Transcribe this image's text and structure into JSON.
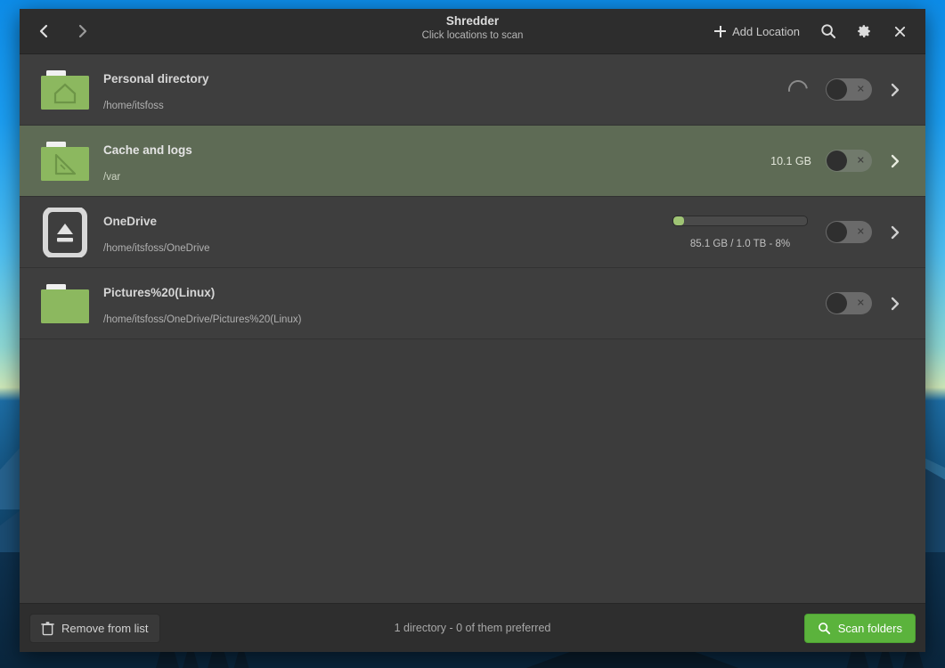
{
  "window": {
    "title": "Shredder",
    "subtitle": "Click locations to scan"
  },
  "header": {
    "back_icon": "chevron-left-icon",
    "forward_icon": "chevron-right-icon",
    "add_location_label": "Add Location",
    "add_location_icon": "plus-icon",
    "search_icon": "search-icon",
    "settings_icon": "gear-icon",
    "close_icon": "close-icon"
  },
  "locations": [
    {
      "title": "Personal directory",
      "path": "/home/itsfoss",
      "icon": "home-folder-icon",
      "selected": false,
      "size": "",
      "spinner": true,
      "toggle_on": false,
      "progress": null
    },
    {
      "title": "Cache and logs",
      "path": "/var",
      "icon": "folder-ruler-icon",
      "selected": true,
      "size": "10.1 GB",
      "spinner": false,
      "toggle_on": false,
      "progress": null
    },
    {
      "title": "OneDrive",
      "path": "/home/itsfoss/OneDrive",
      "icon": "drive-eject-icon",
      "selected": false,
      "size": "",
      "spinner": false,
      "toggle_on": false,
      "progress": {
        "percent": 8,
        "label": "85.1 GB / 1.0 TB - 8%",
        "fill_color": "#9fc474"
      }
    },
    {
      "title": "Pictures%20(Linux)",
      "path": "/home/itsfoss/OneDrive/Pictures%20(Linux)",
      "icon": "folder-icon",
      "selected": false,
      "size": "",
      "spinner": false,
      "toggle_on": false,
      "progress": null
    }
  ],
  "footer": {
    "remove_label": "Remove from list",
    "remove_icon": "trash-icon",
    "status": "1 directory  -  0 of them preferred",
    "scan_label": "Scan folders",
    "scan_icon": "search-icon"
  },
  "colors": {
    "accent_green": "#5bb33c",
    "folder_green": "#8cb85f",
    "selected_row": "#5e6b55",
    "window_bg": "#3c3c3c",
    "header_bg": "#2d2d2d"
  }
}
